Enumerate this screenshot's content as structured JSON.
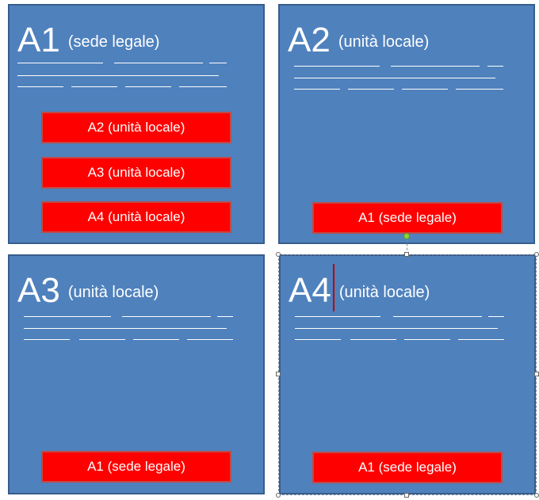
{
  "panels": [
    {
      "id": "A1",
      "code": "A1",
      "subtitle": "(sede legale)",
      "links": [
        "A2 (unità locale)",
        "A3 (unità locale)",
        "A4 (unità locale)"
      ]
    },
    {
      "id": "A2",
      "code": "A2",
      "subtitle": "(unità locale)",
      "links": [
        "A1 (sede legale)"
      ]
    },
    {
      "id": "A3",
      "code": "A3",
      "subtitle": "(unità locale)",
      "links": [
        "A1 (sede legale)"
      ]
    },
    {
      "id": "A4",
      "code": "A4",
      "subtitle": "(unità locale)",
      "links": [
        "A1 (sede legale)"
      ],
      "selected": true
    }
  ],
  "colors": {
    "panel_fill": "#4f81bd",
    "panel_border": "#385d8a",
    "button_fill": "#ff0000",
    "text": "#ffffff"
  }
}
